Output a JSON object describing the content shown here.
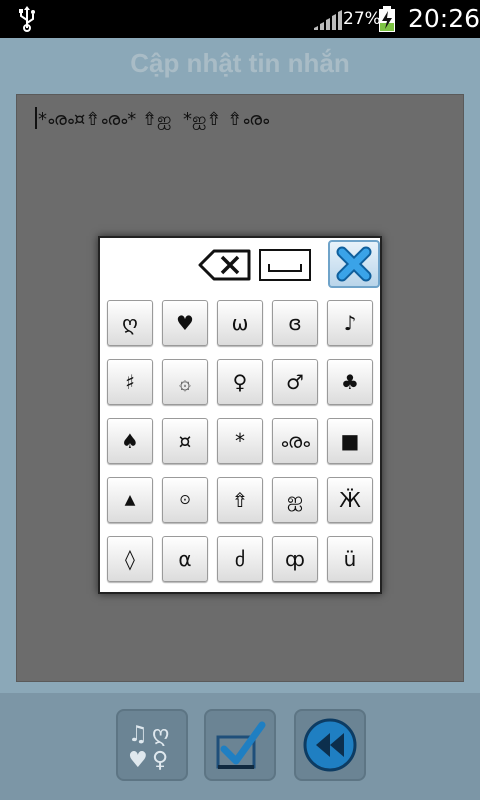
{
  "status_bar": {
    "battery_percent": "27%",
    "time": "20:26"
  },
  "app": {
    "title": "Cập nhật tin nhắn",
    "editor_text": "*ൟ¤⇮ൟ* ⇮ஐ  *ஐ⇮ ⇮ൟ"
  },
  "dialog": {
    "rows": [
      [
        "ღ",
        "♥",
        "ω",
        "ɞ",
        "♪"
      ],
      [
        "♯",
        "۞",
        "♀",
        "♂",
        "♣"
      ],
      [
        "♠",
        "¤",
        "*",
        "ൟ",
        "■"
      ],
      [
        "▲",
        "⊙",
        "⇮",
        "ஐ",
        "Ӝ"
      ],
      [
        "◊",
        "α",
        "ძ",
        "ȹ",
        "ü"
      ]
    ]
  },
  "colors": {
    "app_bg": "#8ba8b8",
    "editor_bg": "#6c6c6c",
    "accent": "#1f7fc2"
  }
}
